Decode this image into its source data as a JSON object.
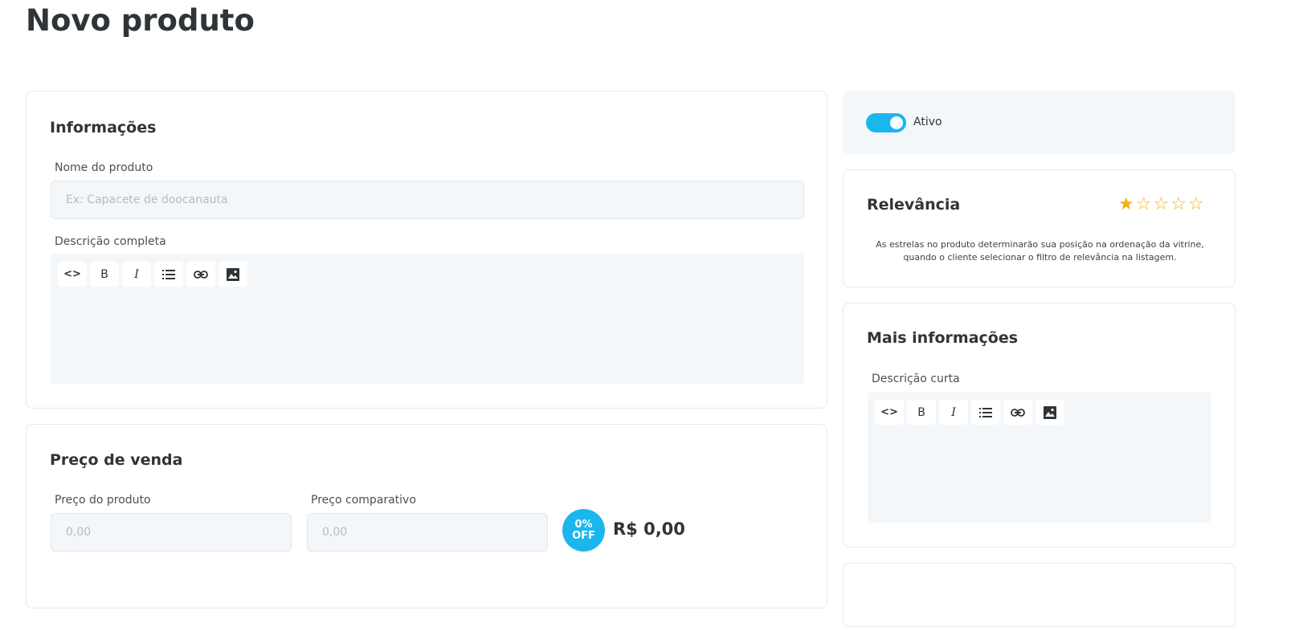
{
  "page": {
    "title": "Novo produto"
  },
  "info": {
    "title": "Informações",
    "name_label": "Nome do produto",
    "name_placeholder": "Ex: Capacete de doocanauta",
    "name_value": "",
    "description_label": "Descrição completa"
  },
  "toolbar": {
    "code_label": "<>",
    "bold_label": "B",
    "italic_label": "I"
  },
  "pricing": {
    "title": "Preço de venda",
    "price_label": "Preço do produto",
    "price_placeholder": "0,00",
    "compare_label": "Preço comparativo",
    "compare_placeholder": "0,00",
    "discount_percent": "0%",
    "discount_off": "OFF",
    "final_price": "R$ 0,00"
  },
  "status": {
    "active_label": "Ativo",
    "active": true
  },
  "relevance": {
    "title": "Relevância",
    "rating": 1,
    "max": 5,
    "help_line1": "As estrelas no produto determinarão sua posição na ordenação da vitrine,",
    "help_line2": "quando o cliente selecionar o filtro de relevância na listagem."
  },
  "more_info": {
    "title": "Mais informações",
    "short_description_label": "Descrição curta"
  },
  "colors": {
    "accent": "#1cb6ee",
    "star": "#f2b116",
    "field_bg": "#f4f7fa",
    "text": "#2f3437"
  }
}
